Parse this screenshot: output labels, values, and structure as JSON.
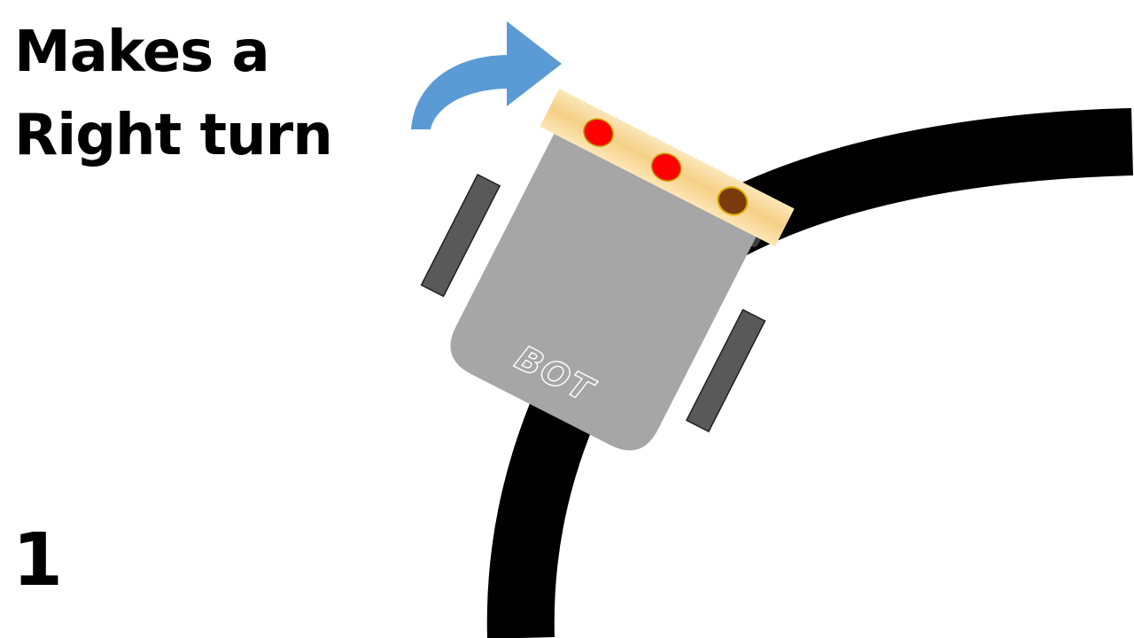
{
  "caption": {
    "line1": "Makes a",
    "line2": "Right turn"
  },
  "step_number": "1",
  "robot": {
    "label": "BOT",
    "sensors": [
      {
        "name": "left-sensor",
        "state": "on",
        "color": "#ff0000"
      },
      {
        "name": "center-sensor",
        "state": "on",
        "color": "#ff0000"
      },
      {
        "name": "right-sensor",
        "state": "off",
        "color": "#7b3a0c"
      }
    ],
    "body_color": "#a6a6a6",
    "wheel_color": "#595959",
    "sensor_bar_color": "#f7d79a"
  },
  "track": {
    "color": "#000000"
  },
  "turn_arrow": {
    "direction": "right",
    "color": "#5b9bd5"
  }
}
